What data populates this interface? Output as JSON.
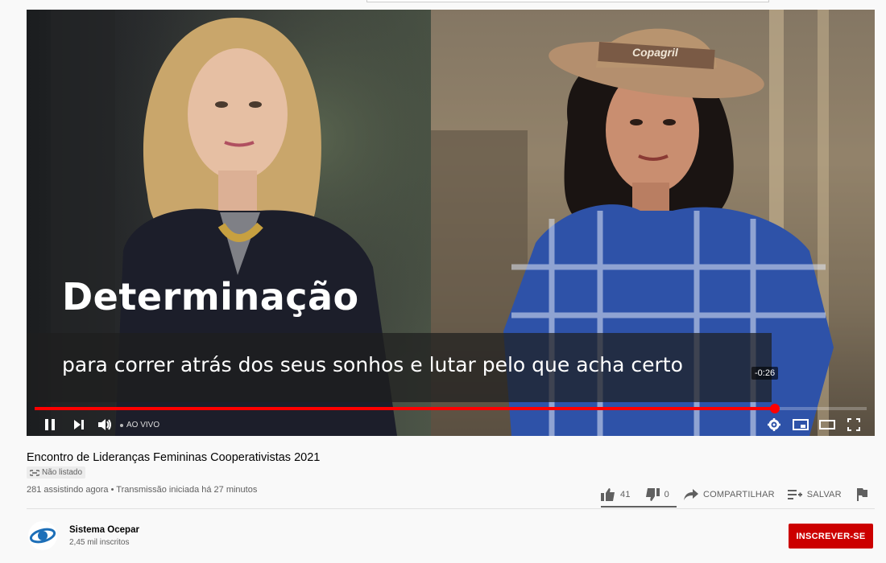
{
  "video": {
    "caption_title": "Determinação",
    "caption_subtitle": "para correr atrás dos seus sonhos e lutar pelo que acha certo",
    "time_remaining": "-0:26",
    "progress": 0.89,
    "live_label": "AO VIVO",
    "hat_text": "Copagril",
    "icons": [
      "pause-icon",
      "next-icon",
      "volume-icon",
      "settings-icon",
      "miniplayer-icon",
      "theater-icon",
      "fullscreen-icon"
    ]
  },
  "info": {
    "title": "Encontro de Lideranças Femininas Cooperativistas 2021",
    "badge": "Não listado",
    "meta": "281 assistindo agora • Transmissão iniciada há 27 minutos",
    "likes": "41",
    "dislikes": "0",
    "share_label": "COMPARTILHAR",
    "save_label": "SALVAR"
  },
  "channel": {
    "name": "Sistema Ocepar",
    "subscribers": "2,45 mil inscritos",
    "subscribe_label": "INSCREVER-SE"
  },
  "colors": {
    "accent": "#ff0000",
    "subscribe": "#cc0000",
    "text": "#030303",
    "muted": "#606060"
  }
}
